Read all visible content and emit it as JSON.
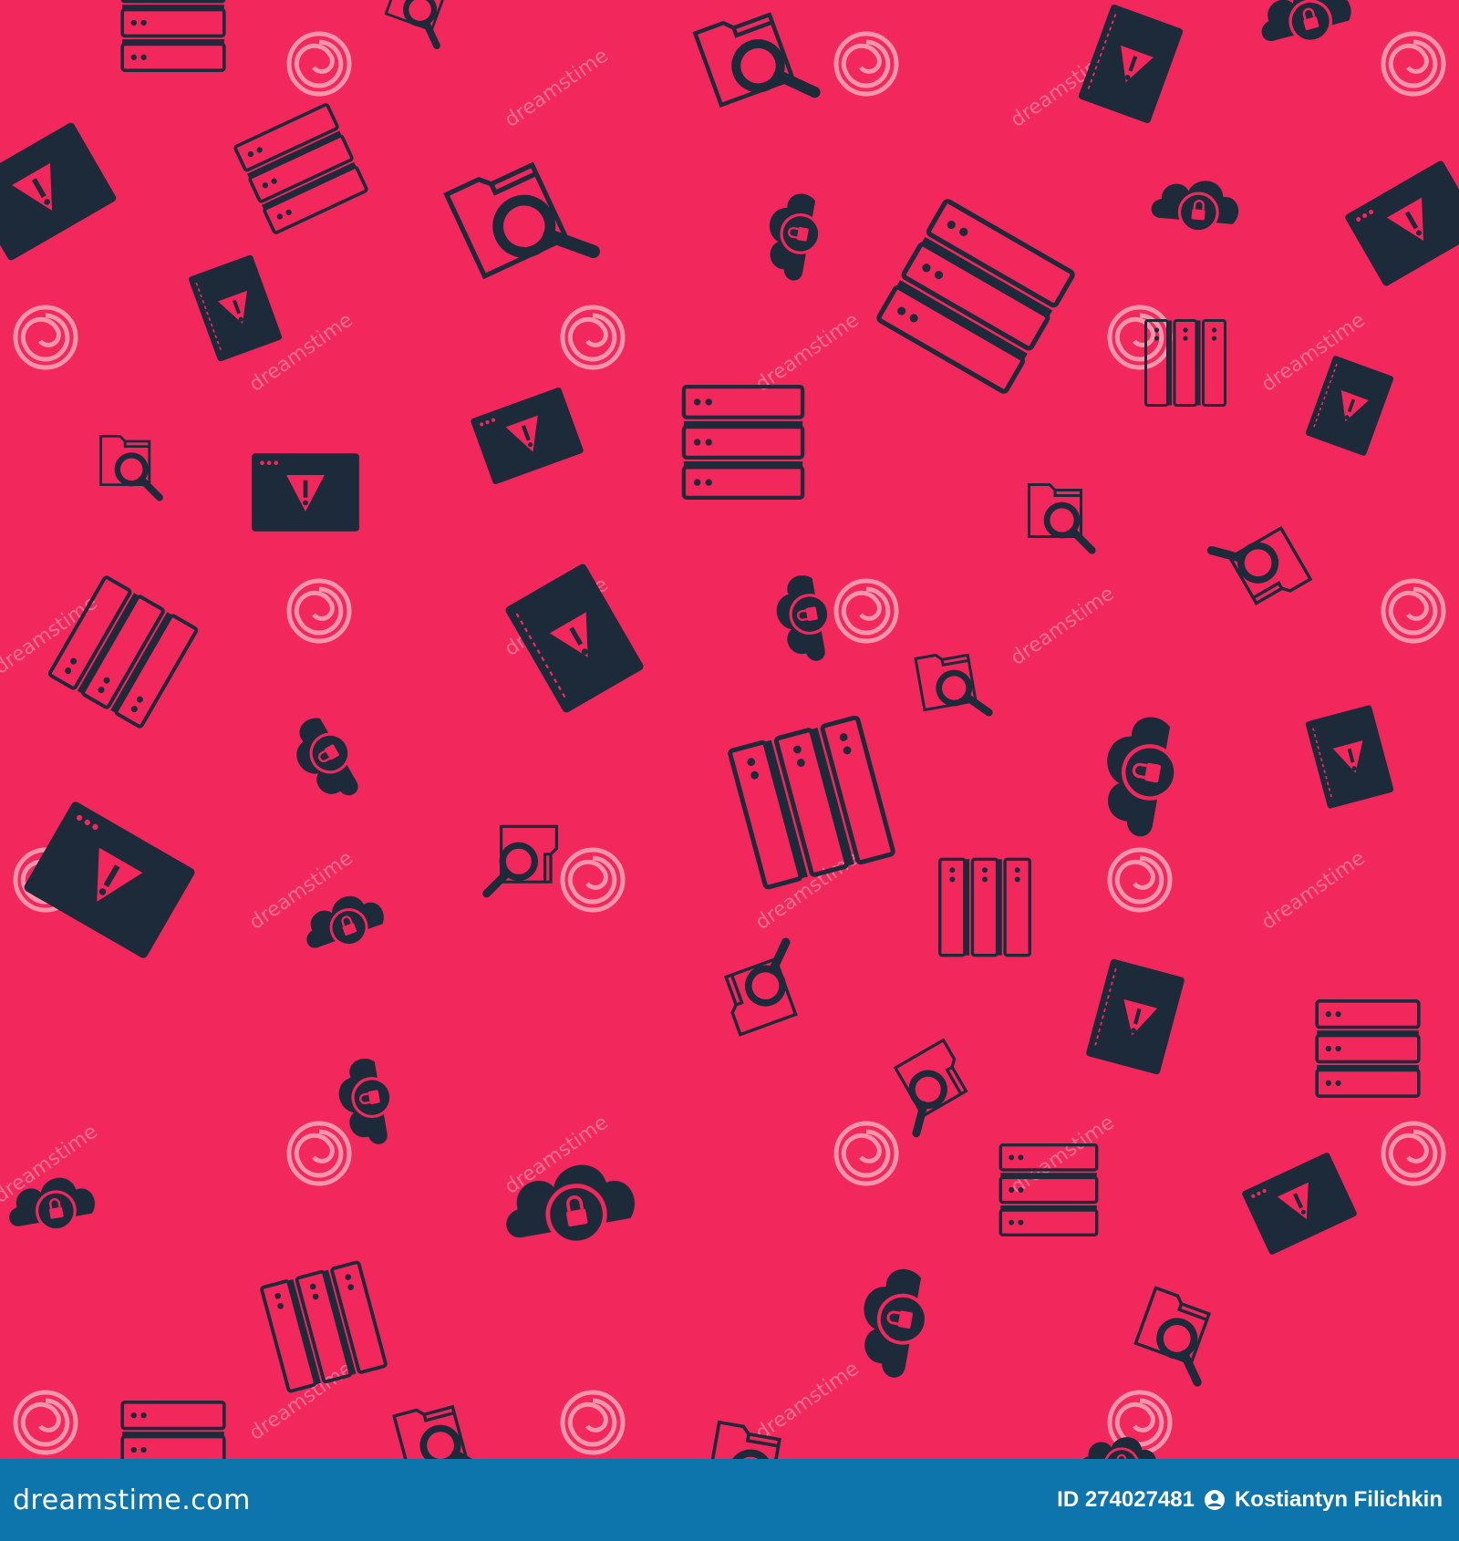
{
  "background_color": "#f2275c",
  "icon_color": "#1c2a3a",
  "watermark_color": "#f9a2b5",
  "footer_color": "#0e74ac",
  "icons": [
    "server-icon",
    "warning-browser-icon",
    "folder-search-icon",
    "cloud-lock-icon",
    "warning-book-icon"
  ],
  "watermark": {
    "text": "dreamstime",
    "spiral_icon": "dreamstime-spiral-logo"
  },
  "footer": {
    "brand": "dreamstime.com",
    "id_label": "ID 274027481",
    "author": "Kostiantyn Filichkin",
    "person_icon": "person-circle-icon"
  }
}
